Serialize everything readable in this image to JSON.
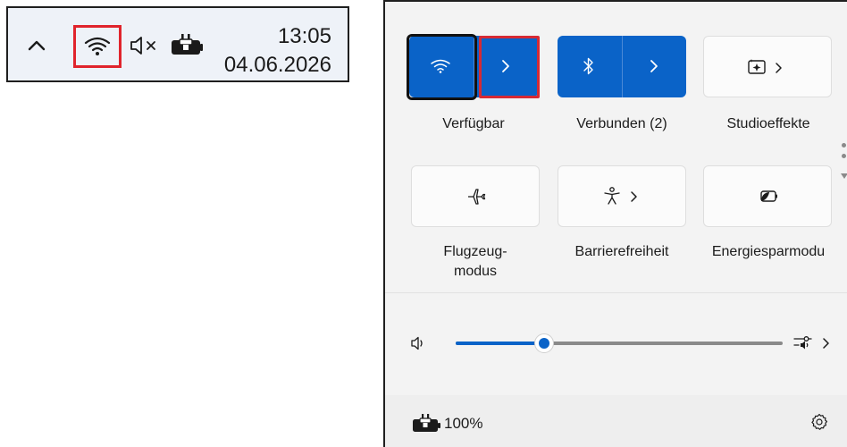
{
  "taskbar": {
    "icons": [
      "chevron-up-icon",
      "wifi-icon",
      "volume-muted-icon",
      "battery-charging-icon"
    ],
    "time": "13:05",
    "date": "04.06.2026"
  },
  "quick_settings": {
    "tiles": [
      {
        "name": "wifi",
        "label": "Verfügbar",
        "state": "on",
        "icon": "wifi-icon"
      },
      {
        "name": "bluetooth",
        "label": "Verbunden (2)",
        "state": "on",
        "icon": "bluetooth-icon"
      },
      {
        "name": "studio-effects",
        "label": "Studioeffekte",
        "state": "off",
        "icon": "studio-effects-icon"
      },
      {
        "name": "airplane-mode",
        "label": "Flugzeug-\nmodus",
        "state": "off",
        "icon": "airplane-icon"
      },
      {
        "name": "accessibility",
        "label": "Barrierefreiheit",
        "state": "off",
        "icon": "accessibility-icon"
      },
      {
        "name": "energy-saver",
        "label": "Energiesparmodu",
        "state": "off",
        "icon": "energy-saver-icon"
      }
    ],
    "volume": {
      "level_fraction": 0.27,
      "icon": "speaker-icon",
      "output_icon": "audio-output-icon"
    },
    "footer": {
      "battery_text": "100%",
      "battery_icon": "battery-charging-icon",
      "settings_icon": "settings-gear-icon"
    }
  },
  "colors": {
    "accent": "#0a63c8",
    "highlight_red": "#e0242c",
    "panel_bg": "#f3f3f3",
    "taskbar_bg": "#eef2f8"
  }
}
